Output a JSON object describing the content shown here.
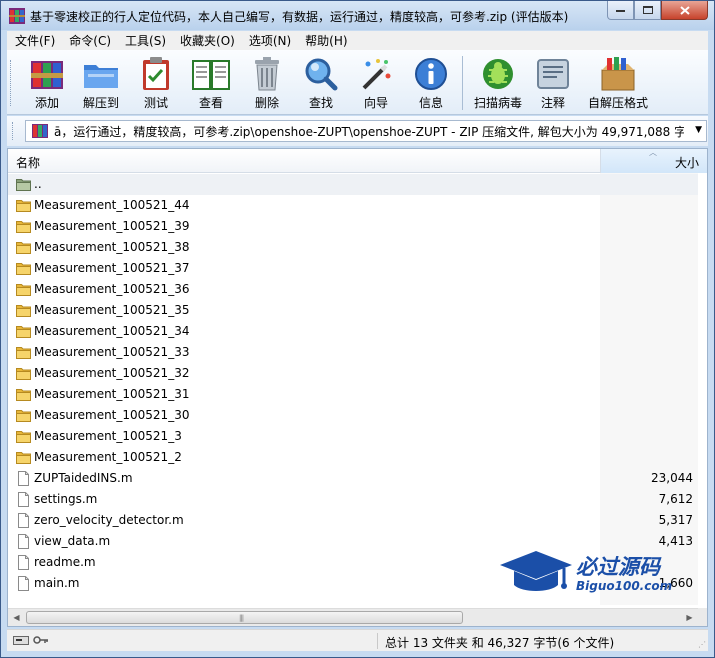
{
  "window": {
    "title": "基于零速校正的行人定位代码，本人自己编写，有数据，运行通过，精度较高，可参考.zip (评估版本)"
  },
  "menu": [
    "文件(F)",
    "命令(C)",
    "工具(S)",
    "收藏夹(O)",
    "选项(N)",
    "帮助(H)"
  ],
  "toolbar": {
    "add": "添加",
    "extract": "解压到",
    "test": "测试",
    "view": "查看",
    "delete": "删除",
    "find": "查找",
    "wizard": "向导",
    "info": "信息",
    "virus": "扫描病毒",
    "comment": "注释",
    "sfx": "自解压格式"
  },
  "address": {
    "path": "ā，运行通过，精度较高，可参考.zip\\openshoe-ZUPT\\openshoe-ZUPT - ZIP 压缩文件, 解包大小为 49,971,088 字节"
  },
  "columns": {
    "name": "名称",
    "size": "大小"
  },
  "files": [
    {
      "name": "..",
      "size": "",
      "type": "parent"
    },
    {
      "name": "Measurement_100521_44",
      "size": "",
      "type": "folder"
    },
    {
      "name": "Measurement_100521_39",
      "size": "",
      "type": "folder"
    },
    {
      "name": "Measurement_100521_38",
      "size": "",
      "type": "folder"
    },
    {
      "name": "Measurement_100521_37",
      "size": "",
      "type": "folder"
    },
    {
      "name": "Measurement_100521_36",
      "size": "",
      "type": "folder"
    },
    {
      "name": "Measurement_100521_35",
      "size": "",
      "type": "folder"
    },
    {
      "name": "Measurement_100521_34",
      "size": "",
      "type": "folder"
    },
    {
      "name": "Measurement_100521_33",
      "size": "",
      "type": "folder"
    },
    {
      "name": "Measurement_100521_32",
      "size": "",
      "type": "folder"
    },
    {
      "name": "Measurement_100521_31",
      "size": "",
      "type": "folder"
    },
    {
      "name": "Measurement_100521_30",
      "size": "",
      "type": "folder"
    },
    {
      "name": "Measurement_100521_3",
      "size": "",
      "type": "folder"
    },
    {
      "name": "Measurement_100521_2",
      "size": "",
      "type": "folder"
    },
    {
      "name": "ZUPTaidedINS.m",
      "size": "23,044",
      "type": "file"
    },
    {
      "name": "settings.m",
      "size": "7,612",
      "type": "file"
    },
    {
      "name": "zero_velocity_detector.m",
      "size": "5,317",
      "type": "file"
    },
    {
      "name": "view_data.m",
      "size": "4,413",
      "type": "file"
    },
    {
      "name": "readme.m",
      "size": "",
      "type": "file"
    },
    {
      "name": "main.m",
      "size": "1,660",
      "type": "file"
    }
  ],
  "status": {
    "summary": "总计 13 文件夹 和 46,327 字节(6 个文件)"
  },
  "watermark": {
    "line1": "必过源码",
    "line2": "Biguo100.com"
  },
  "colors": {
    "folder": "#e8b73a",
    "accent": "#1b4fa8",
    "frame": "#c7dbf1"
  }
}
